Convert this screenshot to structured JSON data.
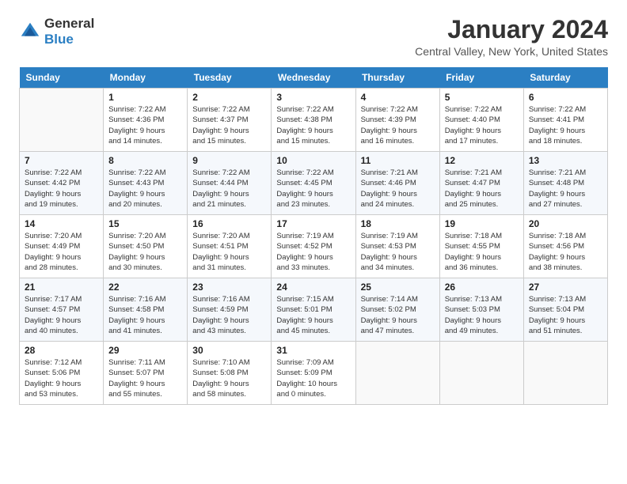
{
  "header": {
    "logo_general": "General",
    "logo_blue": "Blue",
    "title": "January 2024",
    "subtitle": "Central Valley, New York, United States"
  },
  "weekdays": [
    "Sunday",
    "Monday",
    "Tuesday",
    "Wednesday",
    "Thursday",
    "Friday",
    "Saturday"
  ],
  "weeks": [
    [
      {
        "day": "",
        "info": ""
      },
      {
        "day": "1",
        "info": "Sunrise: 7:22 AM\nSunset: 4:36 PM\nDaylight: 9 hours\nand 14 minutes."
      },
      {
        "day": "2",
        "info": "Sunrise: 7:22 AM\nSunset: 4:37 PM\nDaylight: 9 hours\nand 15 minutes."
      },
      {
        "day": "3",
        "info": "Sunrise: 7:22 AM\nSunset: 4:38 PM\nDaylight: 9 hours\nand 15 minutes."
      },
      {
        "day": "4",
        "info": "Sunrise: 7:22 AM\nSunset: 4:39 PM\nDaylight: 9 hours\nand 16 minutes."
      },
      {
        "day": "5",
        "info": "Sunrise: 7:22 AM\nSunset: 4:40 PM\nDaylight: 9 hours\nand 17 minutes."
      },
      {
        "day": "6",
        "info": "Sunrise: 7:22 AM\nSunset: 4:41 PM\nDaylight: 9 hours\nand 18 minutes."
      }
    ],
    [
      {
        "day": "7",
        "info": "Sunrise: 7:22 AM\nSunset: 4:42 PM\nDaylight: 9 hours\nand 19 minutes."
      },
      {
        "day": "8",
        "info": "Sunrise: 7:22 AM\nSunset: 4:43 PM\nDaylight: 9 hours\nand 20 minutes."
      },
      {
        "day": "9",
        "info": "Sunrise: 7:22 AM\nSunset: 4:44 PM\nDaylight: 9 hours\nand 21 minutes."
      },
      {
        "day": "10",
        "info": "Sunrise: 7:22 AM\nSunset: 4:45 PM\nDaylight: 9 hours\nand 23 minutes."
      },
      {
        "day": "11",
        "info": "Sunrise: 7:21 AM\nSunset: 4:46 PM\nDaylight: 9 hours\nand 24 minutes."
      },
      {
        "day": "12",
        "info": "Sunrise: 7:21 AM\nSunset: 4:47 PM\nDaylight: 9 hours\nand 25 minutes."
      },
      {
        "day": "13",
        "info": "Sunrise: 7:21 AM\nSunset: 4:48 PM\nDaylight: 9 hours\nand 27 minutes."
      }
    ],
    [
      {
        "day": "14",
        "info": "Sunrise: 7:20 AM\nSunset: 4:49 PM\nDaylight: 9 hours\nand 28 minutes."
      },
      {
        "day": "15",
        "info": "Sunrise: 7:20 AM\nSunset: 4:50 PM\nDaylight: 9 hours\nand 30 minutes."
      },
      {
        "day": "16",
        "info": "Sunrise: 7:20 AM\nSunset: 4:51 PM\nDaylight: 9 hours\nand 31 minutes."
      },
      {
        "day": "17",
        "info": "Sunrise: 7:19 AM\nSunset: 4:52 PM\nDaylight: 9 hours\nand 33 minutes."
      },
      {
        "day": "18",
        "info": "Sunrise: 7:19 AM\nSunset: 4:53 PM\nDaylight: 9 hours\nand 34 minutes."
      },
      {
        "day": "19",
        "info": "Sunrise: 7:18 AM\nSunset: 4:55 PM\nDaylight: 9 hours\nand 36 minutes."
      },
      {
        "day": "20",
        "info": "Sunrise: 7:18 AM\nSunset: 4:56 PM\nDaylight: 9 hours\nand 38 minutes."
      }
    ],
    [
      {
        "day": "21",
        "info": "Sunrise: 7:17 AM\nSunset: 4:57 PM\nDaylight: 9 hours\nand 40 minutes."
      },
      {
        "day": "22",
        "info": "Sunrise: 7:16 AM\nSunset: 4:58 PM\nDaylight: 9 hours\nand 41 minutes."
      },
      {
        "day": "23",
        "info": "Sunrise: 7:16 AM\nSunset: 4:59 PM\nDaylight: 9 hours\nand 43 minutes."
      },
      {
        "day": "24",
        "info": "Sunrise: 7:15 AM\nSunset: 5:01 PM\nDaylight: 9 hours\nand 45 minutes."
      },
      {
        "day": "25",
        "info": "Sunrise: 7:14 AM\nSunset: 5:02 PM\nDaylight: 9 hours\nand 47 minutes."
      },
      {
        "day": "26",
        "info": "Sunrise: 7:13 AM\nSunset: 5:03 PM\nDaylight: 9 hours\nand 49 minutes."
      },
      {
        "day": "27",
        "info": "Sunrise: 7:13 AM\nSunset: 5:04 PM\nDaylight: 9 hours\nand 51 minutes."
      }
    ],
    [
      {
        "day": "28",
        "info": "Sunrise: 7:12 AM\nSunset: 5:06 PM\nDaylight: 9 hours\nand 53 minutes."
      },
      {
        "day": "29",
        "info": "Sunrise: 7:11 AM\nSunset: 5:07 PM\nDaylight: 9 hours\nand 55 minutes."
      },
      {
        "day": "30",
        "info": "Sunrise: 7:10 AM\nSunset: 5:08 PM\nDaylight: 9 hours\nand 58 minutes."
      },
      {
        "day": "31",
        "info": "Sunrise: 7:09 AM\nSunset: 5:09 PM\nDaylight: 10 hours\nand 0 minutes."
      },
      {
        "day": "",
        "info": ""
      },
      {
        "day": "",
        "info": ""
      },
      {
        "day": "",
        "info": ""
      }
    ]
  ]
}
